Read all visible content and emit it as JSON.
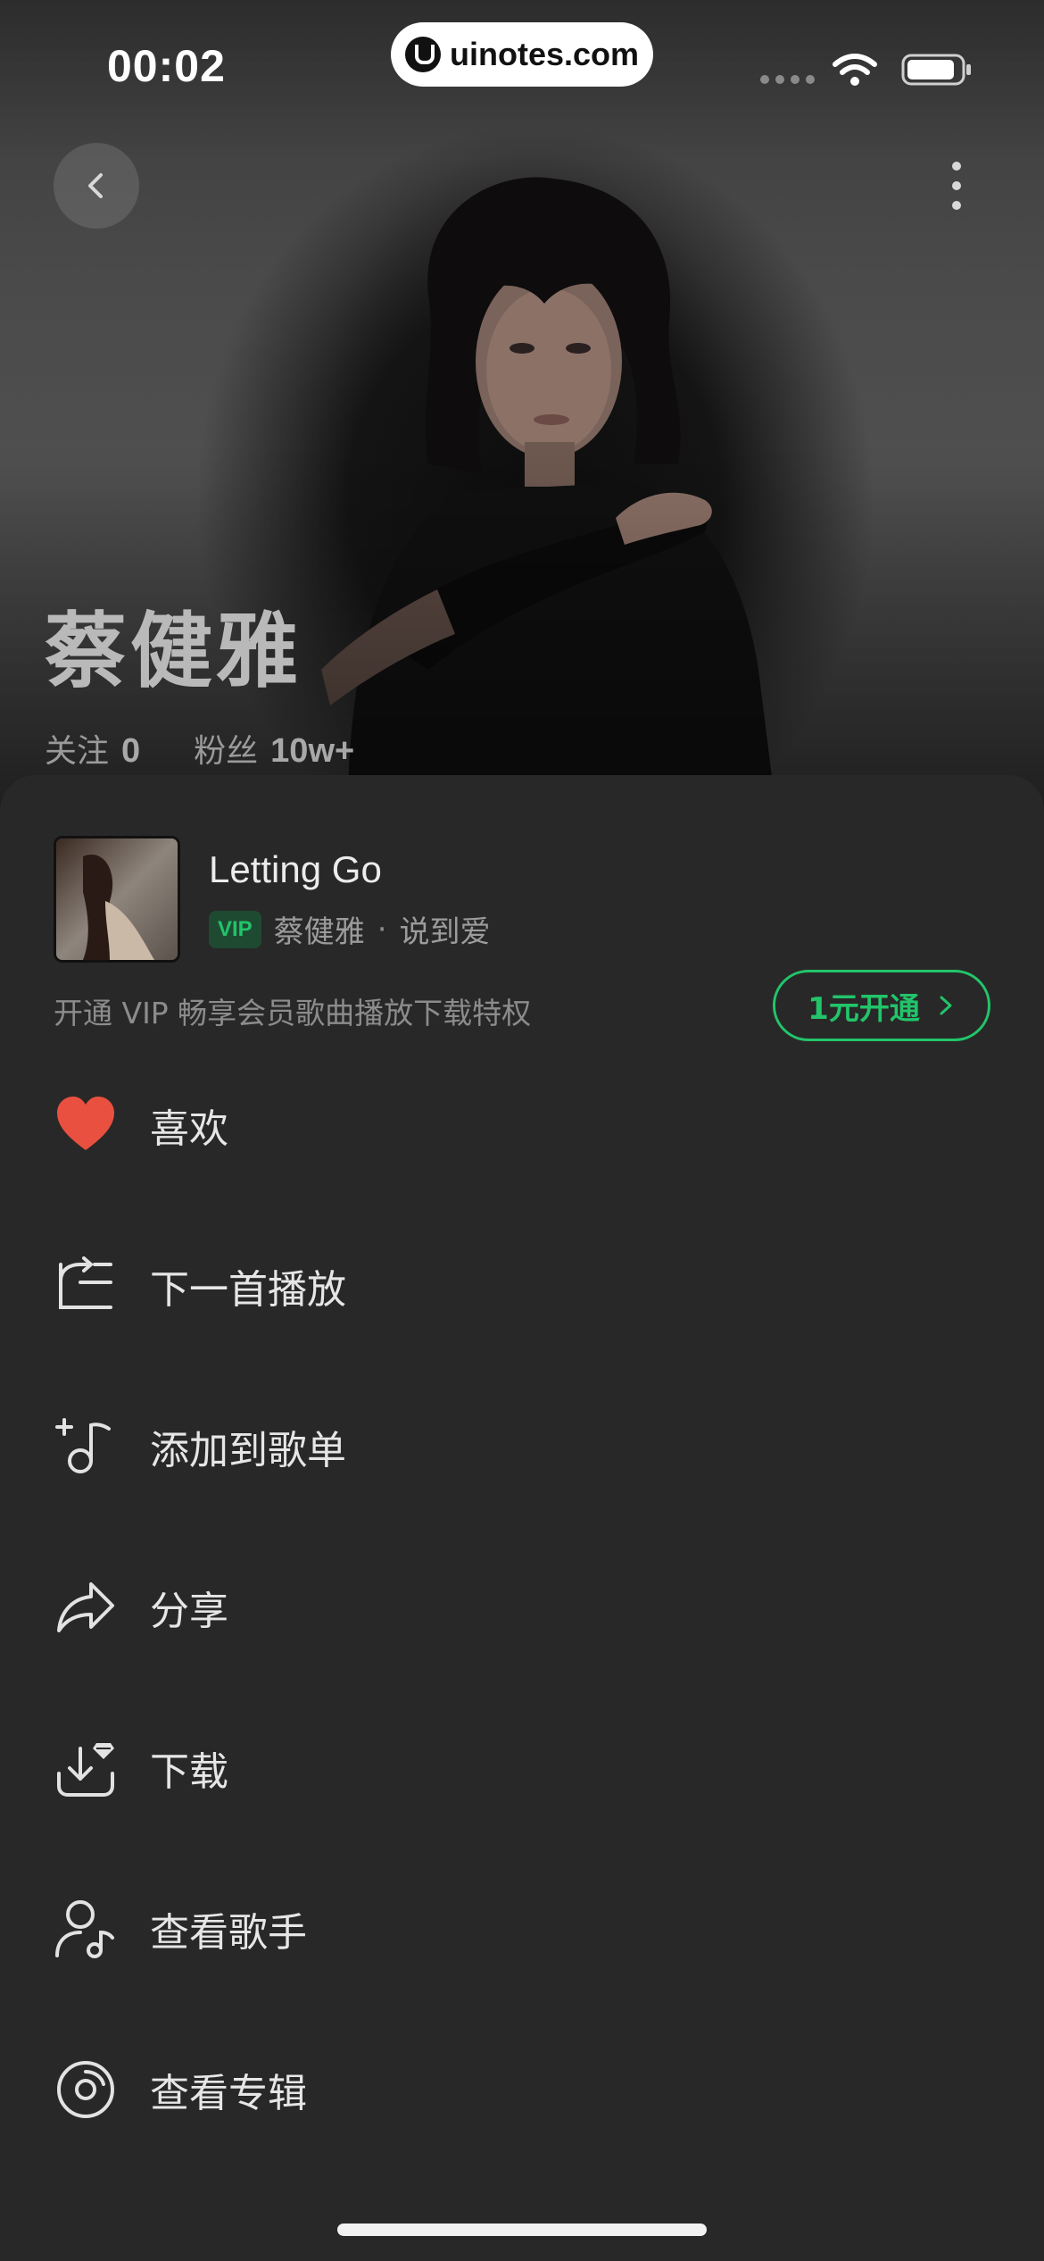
{
  "status_bar": {
    "time": "00:02",
    "watermark": "uinotes.com"
  },
  "artist": {
    "name": "蔡健雅",
    "following_label": "关注",
    "following_count": "0",
    "fans_label": "粉丝",
    "fans_count": "10w+"
  },
  "song": {
    "title": "Letting Go",
    "vip_badge": "VIP",
    "artist": "蔡健雅",
    "separator": "·",
    "album": "说到爱"
  },
  "vip_promo": {
    "text": "开通 VIP 畅享会员歌曲播放下载特权",
    "button_label": "1元开通"
  },
  "actions": [
    {
      "label": "喜欢",
      "icon": "heart-icon"
    },
    {
      "label": "下一首播放",
      "icon": "play-next-icon"
    },
    {
      "label": "添加到歌单",
      "icon": "add-to-playlist-icon"
    },
    {
      "label": "分享",
      "icon": "share-icon"
    },
    {
      "label": "下载",
      "icon": "download-icon"
    },
    {
      "label": "查看歌手",
      "icon": "artist-icon"
    },
    {
      "label": "查看专辑",
      "icon": "album-icon"
    }
  ],
  "colors": {
    "accent_green": "#22c46a",
    "like_red": "#e9503f",
    "sheet_bg": "#282828"
  }
}
